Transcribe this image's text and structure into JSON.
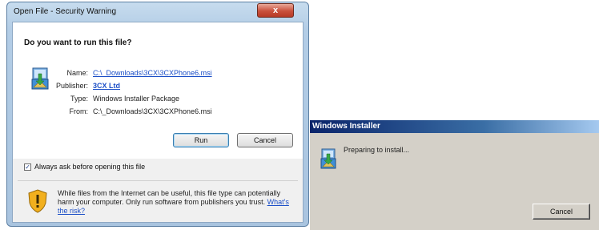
{
  "security_dialog": {
    "title": "Open File - Security Warning",
    "close_label": "x",
    "heading": "Do you want to run this file?",
    "fields": {
      "name_label": "Name:",
      "name_value": "C:\\_Downloads\\3CX\\3CXPhone6.msi",
      "publisher_label": "Publisher:",
      "publisher_value": "3CX Ltd",
      "type_label": "Type:",
      "type_value": "Windows Installer Package",
      "from_label": "From:",
      "from_value": "C:\\_Downloads\\3CX\\3CXPhone6.msi"
    },
    "run_label": "Run",
    "cancel_label": "Cancel",
    "checkbox_label": "Always ask before opening this file",
    "checkbox_checked": true,
    "warning_text": "While files from the Internet can be useful, this file type can potentially harm your computer. Only run software from publishers you trust.",
    "risk_link": "What's the risk?"
  },
  "installer_dialog": {
    "title": "Windows Installer",
    "status_text": "Preparing to install...",
    "cancel_label": "Cancel"
  }
}
